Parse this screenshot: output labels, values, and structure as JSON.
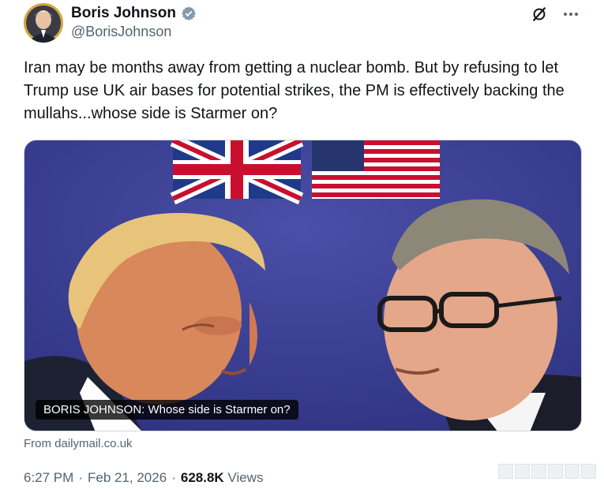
{
  "author": {
    "display_name": "Boris Johnson",
    "handle": "@BorisJohnson",
    "verified": true
  },
  "icons": {
    "grok": "grok-icon",
    "more": "more-icon",
    "verified": "verified-badge-icon"
  },
  "tweet": {
    "text": "Iran may be months away from getting a nuclear bomb. But by refusing to let Trump use UK air bases for potential strikes, the PM is effectively backing the mullahs...whose side is Starmer on?"
  },
  "media": {
    "caption": "BORIS JOHNSON: Whose side is Starmer on?"
  },
  "card": {
    "source": "From dailymail.co.uk"
  },
  "meta": {
    "time": "6:27 PM",
    "sep1": "·",
    "date": "Feb 21, 2026",
    "sep2": "·",
    "views_count": "628.8K",
    "views_label": "Views"
  },
  "colors": {
    "text": "#0f1419",
    "secondary": "#536471",
    "verified": "#829aab",
    "backdrop": "#3c3f8f"
  }
}
